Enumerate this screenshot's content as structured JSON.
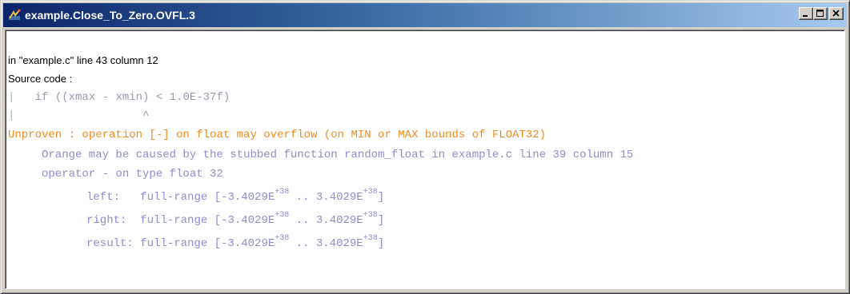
{
  "window": {
    "title": "example.Close_To_Zero.OVFL.3",
    "icon": "polyspace-app-icon",
    "buttons": [
      "minimize",
      "maximize",
      "close"
    ]
  },
  "content": {
    "location": "in \"example.c\" line 43 column 12",
    "source_label": "Source code :",
    "code_bar": "|",
    "code_line": "if ((xmax - xmin) < 1.0E-37f)",
    "caret": "^",
    "verdict": "Unproven : operation [-] on float may overflow (on MIN or MAX bounds of FLOAT32)",
    "orange_cause": "Orange may be caused by the stubbed function random_float in example.c line 39 column 15",
    "operator_line": "operator - on type float 32",
    "ranges": [
      {
        "label": "left:",
        "range_prefix": "full-range [-3.4029E",
        "exp1": "+38",
        "range_mid": " .. 3.4029E",
        "exp2": "+38",
        "range_suffix": "]"
      },
      {
        "label": "right:",
        "range_prefix": "full-range [-3.4029E",
        "exp1": "+38",
        "range_mid": " .. 3.4029E",
        "exp2": "+38",
        "range_suffix": "]"
      },
      {
        "label": "result:",
        "range_prefix": "full-range [-3.4029E",
        "exp1": "+38",
        "range_mid": " .. 3.4029E",
        "exp2": "+38",
        "range_suffix": "]"
      }
    ]
  },
  "colors": {
    "title_gradient_start": "#0a246a",
    "title_gradient_end": "#a6caf0",
    "orange_text": "#f08c1e",
    "blue_text": "#8d8dcf",
    "gray_code": "#9a9ab0"
  }
}
